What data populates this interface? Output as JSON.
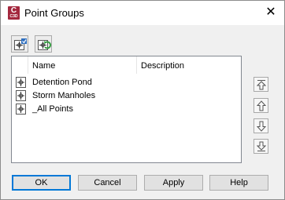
{
  "window": {
    "title": "Point Groups",
    "app_icon": {
      "letter": "C",
      "sublabel": "C3D",
      "color": "#a4283e"
    },
    "close_glyph": "✕"
  },
  "toolbar": {
    "buttons": [
      {
        "icon": "properties-icon"
      },
      {
        "icon": "refresh-icon"
      }
    ]
  },
  "list": {
    "columns": [
      "Name",
      "Description"
    ],
    "rows": [
      {
        "name": "Detention Pond",
        "description": "",
        "icon": "point-group-icon"
      },
      {
        "name": "Storm Manholes",
        "description": "",
        "icon": "point-group-icon"
      },
      {
        "name": "_All Points",
        "description": "",
        "icon": "point-group-icon"
      }
    ]
  },
  "order_buttons": [
    {
      "icon": "move-to-top-icon"
    },
    {
      "icon": "move-up-icon"
    },
    {
      "icon": "move-down-icon"
    },
    {
      "icon": "move-to-bottom-icon"
    }
  ],
  "buttons": {
    "ok": "OK",
    "cancel": "Cancel",
    "apply": "Apply",
    "help": "Help"
  },
  "colors": {
    "accent": "#0078d7",
    "dialog_bg": "#f0f0f0"
  }
}
